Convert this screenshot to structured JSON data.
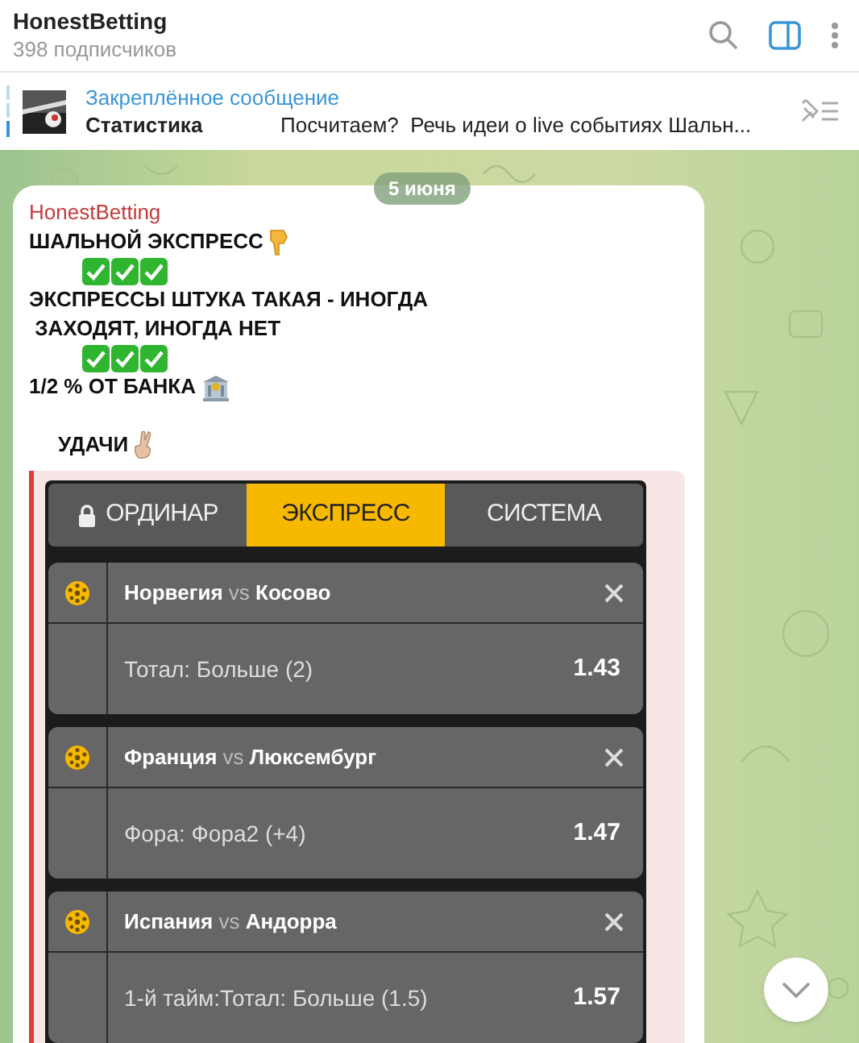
{
  "header": {
    "title": "HonestBetting",
    "subtitle": "398 подписчиков"
  },
  "pinned": {
    "label": "Закреплённое сообщение",
    "title": "Статистика",
    "preview": "Посчитаем?  Речь идеи о live событиях Шальн..."
  },
  "date_badge": "5 июня",
  "message": {
    "author": "HonestBetting",
    "lines": [
      {
        "kind": "title",
        "text": "ШАЛЬНОЙ ЭКСПРЕСС"
      },
      {
        "kind": "checks"
      },
      {
        "kind": "text",
        "text": "ЭКСПРЕССЫ ШТУКА ТАКАЯ - ИНОГДА"
      },
      {
        "kind": "text",
        "text": " ЗАХОДЯТ, ИНОГДА НЕТ"
      },
      {
        "kind": "checks"
      },
      {
        "kind": "stake",
        "text": "1/2 % ОТ БАНКА"
      },
      {
        "kind": "blank"
      },
      {
        "kind": "wish",
        "text": "УДАЧИ"
      }
    ],
    "slip": {
      "tabs": [
        {
          "label": "ОРДИНАР",
          "selected": false,
          "locked": true
        },
        {
          "label": "ЭКСПРЕСС",
          "selected": true,
          "locked": false
        },
        {
          "label": "СИСТЕМА",
          "selected": false,
          "locked": false
        }
      ],
      "bets": [
        {
          "match": "**Норвегия** vs **Косово**",
          "market": "Тотал: Больше (2)",
          "odds": "1.43"
        },
        {
          "match": "**Франция** vs **Люксембург**",
          "market": "Фора: Фора2 (+4)",
          "odds": "1.47"
        },
        {
          "match": "**Испания** vs **Андорра**",
          "market": "1-й тайм:Тотал: Больше (1.5)",
          "odds": "1.57"
        }
      ]
    }
  }
}
